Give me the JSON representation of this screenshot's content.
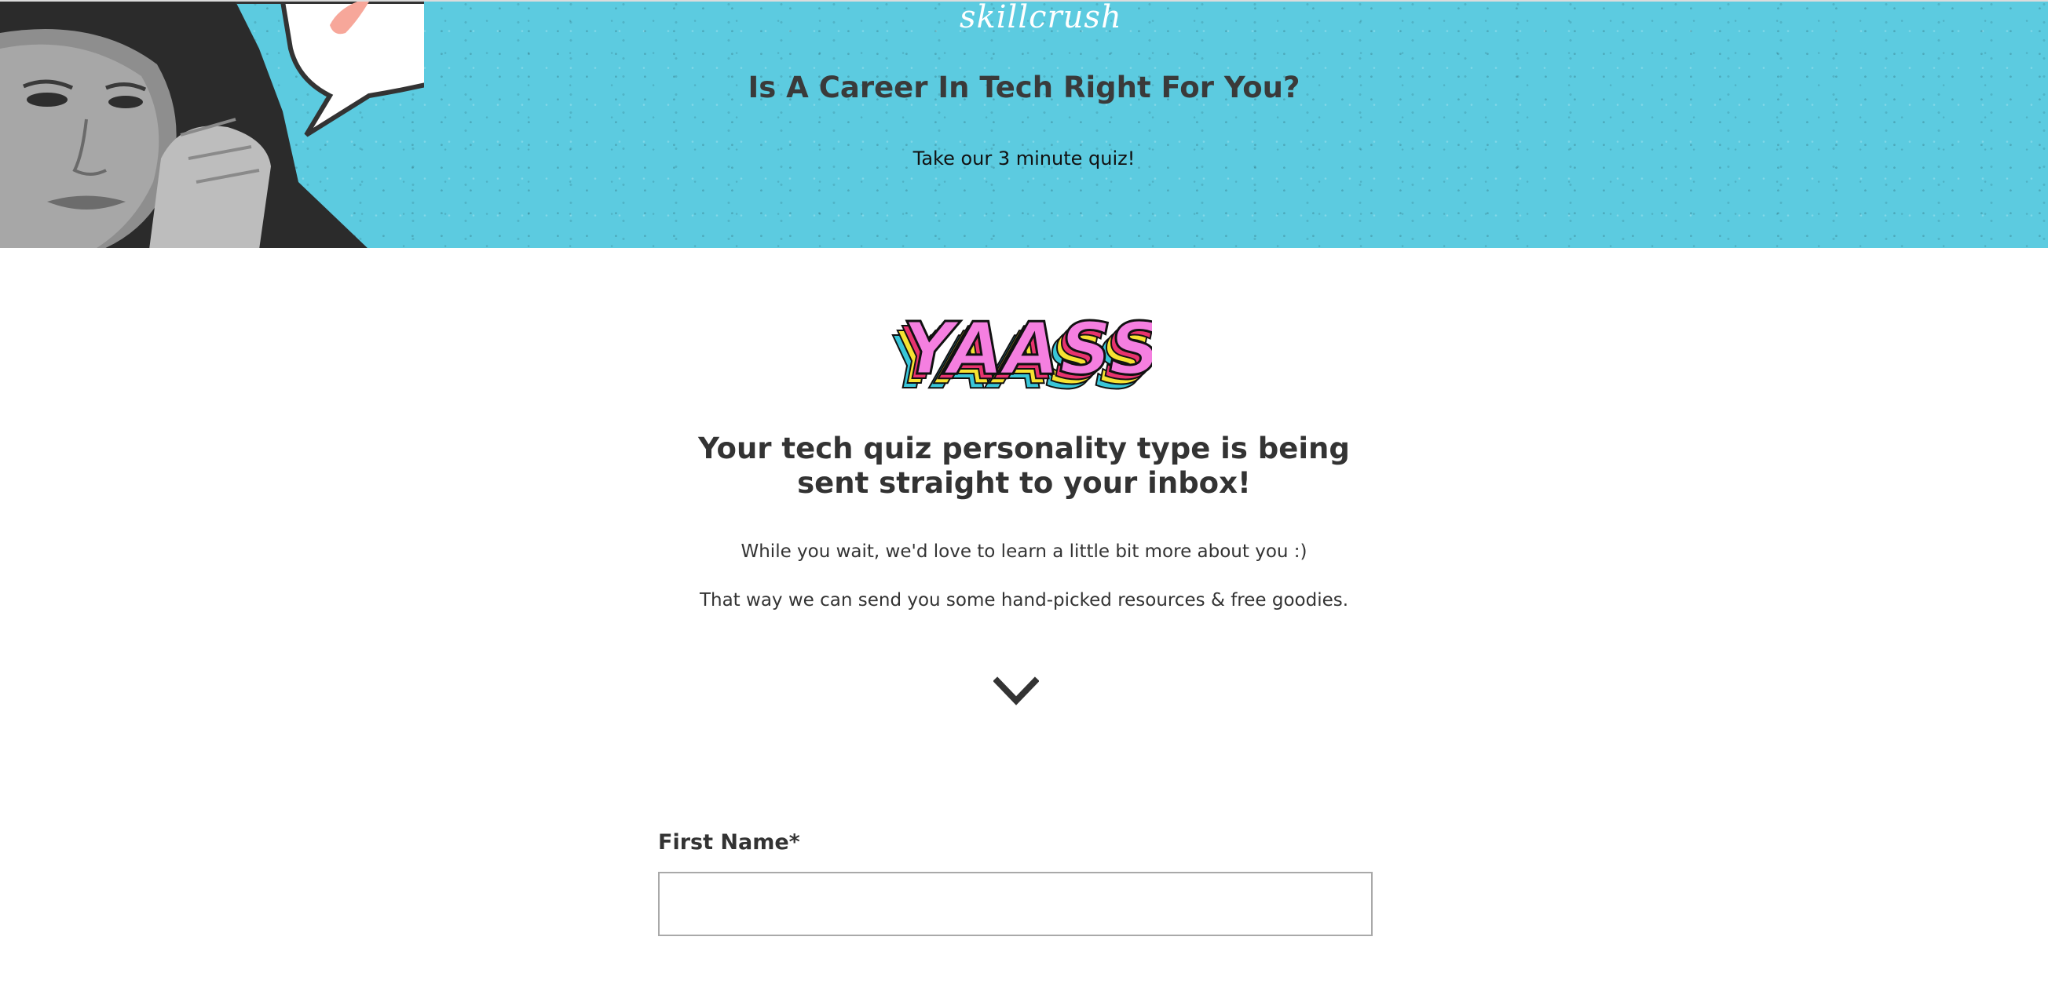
{
  "hero": {
    "brand": "skillcrush",
    "title": "Is A Career In Tech Right For You?",
    "subtitle": "Take our 3 minute quiz!"
  },
  "main": {
    "badge_text": "YAASS",
    "title_line1": "Your tech quiz personality type is being",
    "title_line2": "sent straight to your inbox!",
    "line1": "While you wait, we'd love to learn a little bit more about you :)",
    "line2": "That way we can send you some hand-picked resources & free goodies."
  },
  "form": {
    "first_name_label": "First Name*",
    "first_name_value": ""
  },
  "colors": {
    "hero_bg": "#5ccbe0",
    "text_dark": "#333333",
    "badge_pink": "#f57fe0"
  },
  "icons": {
    "scroll": "chevron-down-icon"
  }
}
